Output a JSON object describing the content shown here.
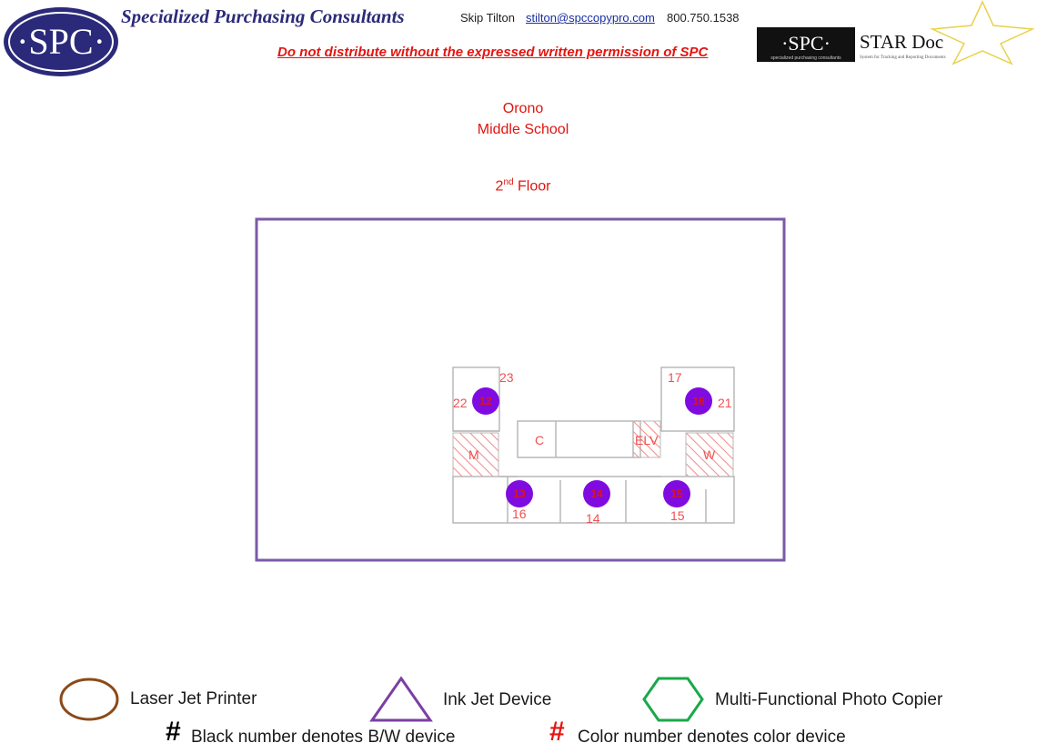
{
  "header": {
    "logo_text": "·SPC·",
    "company": "Specialized Purchasing Consultants",
    "contact_name": "Skip Tilton",
    "contact_email": "stilton@spccopypro.com",
    "contact_phone": "800.750.1538",
    "warning": "Do not distribute without the expressed written permission of SPC",
    "stardoc": {
      "brand": "·SPC·",
      "brand_sub": "specialized purchasing consultants",
      "product": "STAR Doc",
      "tagline": "System for Tracking and Reporting Documents"
    }
  },
  "school": {
    "line1": "Orono",
    "line2": "Middle School"
  },
  "floor": {
    "number": "2",
    "suffix": "nd",
    "label": "Floor"
  },
  "map": {
    "rooms": [
      "C",
      "ELV",
      "M",
      "W"
    ],
    "room_numbers": [
      "23",
      "22",
      "17",
      "21",
      "16",
      "14",
      "15"
    ],
    "devices": [
      {
        "id": "12",
        "type": "laser",
        "color": true
      },
      {
        "id": "16",
        "type": "laser",
        "color": true
      },
      {
        "id": "13",
        "type": "laser",
        "color": true
      },
      {
        "id": "14",
        "type": "laser",
        "color": true
      },
      {
        "id": "15",
        "type": "laser",
        "color": true
      }
    ]
  },
  "legend": {
    "laser": "Laser Jet Printer",
    "inkjet": "Ink Jet Device",
    "mfp": "Multi-Functional Photo Copier",
    "mark": "#",
    "bw": "Black number denotes B/W device",
    "color": "Color number denotes color device"
  },
  "colors": {
    "brand_navy": "#2b2a7a",
    "warning_red": "#e5140f",
    "map_border": "#7a5aa6",
    "device_fill": "#7f0be0",
    "laser_stroke": "#8b4a18",
    "inkjet_stroke": "#7b3fa3",
    "mfp_stroke": "#1aa84a",
    "hatch": "#f08a8a"
  }
}
